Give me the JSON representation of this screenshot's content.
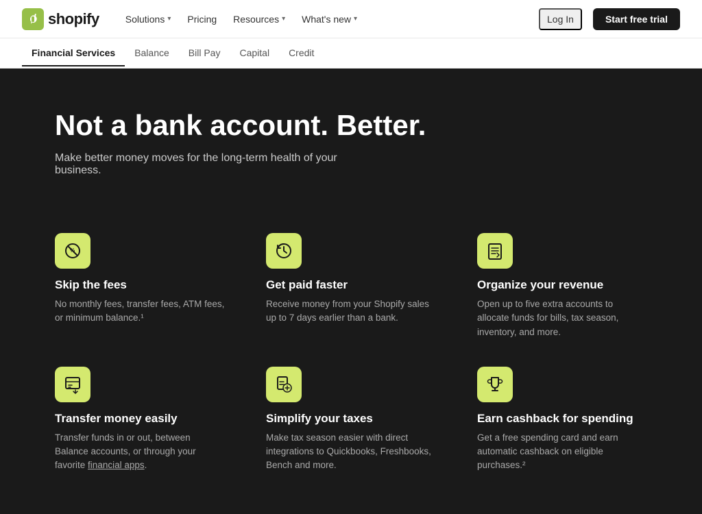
{
  "brand": {
    "logo_text": "shopify"
  },
  "nav": {
    "items": [
      {
        "label": "Solutions",
        "has_dropdown": true
      },
      {
        "label": "Pricing",
        "has_dropdown": false
      },
      {
        "label": "Resources",
        "has_dropdown": true
      },
      {
        "label": "What's new",
        "has_dropdown": true
      }
    ],
    "log_in": "Log In",
    "start_trial": "Start free trial"
  },
  "sub_nav": {
    "items": [
      {
        "label": "Financial Services",
        "active": true
      },
      {
        "label": "Balance",
        "active": false
      },
      {
        "label": "Bill Pay",
        "active": false
      },
      {
        "label": "Capital",
        "active": false
      },
      {
        "label": "Credit",
        "active": false
      }
    ]
  },
  "hero": {
    "heading": "Not a bank account. Better.",
    "subheading": "Make better money moves for the long-term health of your business."
  },
  "features": [
    {
      "icon": "no-fee-icon",
      "title": "Skip the fees",
      "desc": "No monthly fees, transfer fees, ATM fees, or minimum balance.¹",
      "has_link": false
    },
    {
      "icon": "clock-icon",
      "title": "Get paid faster",
      "desc": "Receive money from your Shopify sales up to 7 days earlier than a bank.",
      "has_link": false
    },
    {
      "icon": "revenue-icon",
      "title": "Organize your revenue",
      "desc": "Open up to five extra accounts to allocate funds for bills, tax season, inventory, and more.",
      "has_link": false
    },
    {
      "icon": "transfer-icon",
      "title": "Transfer money easily",
      "desc": "Transfer funds in or out, between Balance accounts, or through your favorite",
      "link_text": "financial apps",
      "desc_after": ".",
      "has_link": true
    },
    {
      "icon": "tax-icon",
      "title": "Simplify your taxes",
      "desc": "Make tax season easier with direct integrations to Quickbooks, Freshbooks, Bench and more.",
      "has_link": false
    },
    {
      "icon": "cashback-icon",
      "title": "Earn cashback for spending",
      "desc": "Get a free spending card and earn automatic cashback on eligible purchases.²",
      "has_link": false
    }
  ]
}
